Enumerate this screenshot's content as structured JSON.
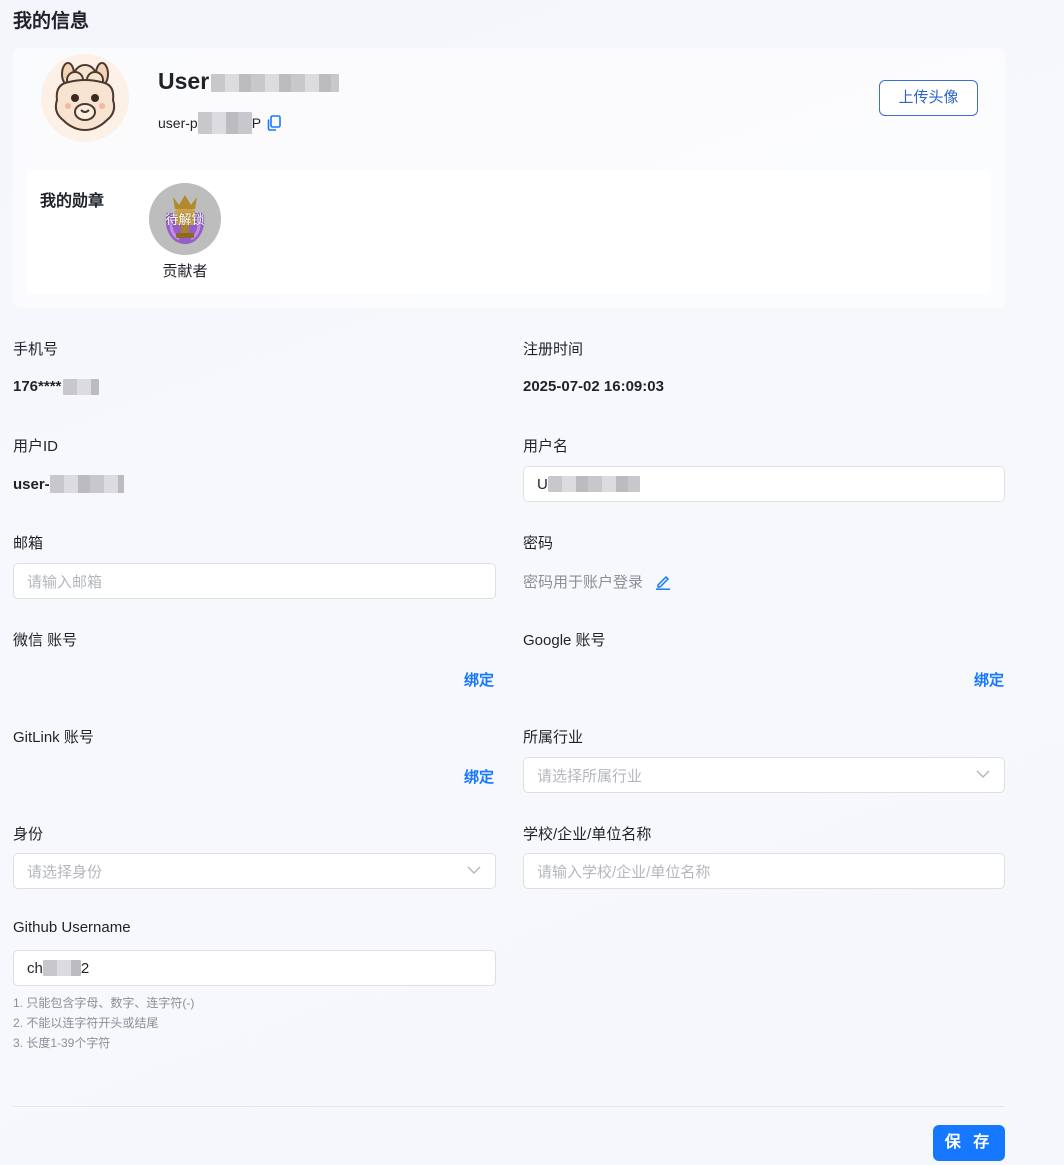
{
  "page": {
    "title": "我的信息"
  },
  "profile": {
    "username_prefix": "User",
    "userid_prefix": "user-p",
    "userid_suffix": "P",
    "upload_label": "上传头像",
    "avatar_icon": "alpaca-avatar",
    "copy_icon": "copy-icon"
  },
  "badges": {
    "title": "我的勋章",
    "items": [
      {
        "name": "贡献者",
        "status": "待解锁"
      }
    ]
  },
  "fields": {
    "phone": {
      "label": "手机号",
      "value": "176****"
    },
    "register_time": {
      "label": "注册时间",
      "value": "2025-07-02 16:09:03"
    },
    "user_id": {
      "label": "用户ID",
      "value": "user-",
      "value_suffix": ""
    },
    "username": {
      "label": "用户名",
      "value": "U"
    },
    "email": {
      "label": "邮箱",
      "placeholder": "请输入邮箱"
    },
    "password": {
      "label": "密码",
      "text": "密码用于账户登录"
    },
    "wechat": {
      "label": "微信 账号",
      "action": "绑定"
    },
    "google": {
      "label": "Google 账号",
      "action": "绑定"
    },
    "gitlink": {
      "label": "GitLink 账号",
      "action": "绑定"
    },
    "industry": {
      "label": "所属行业",
      "placeholder": "请选择所属行业"
    },
    "identity": {
      "label": "身份",
      "placeholder": "请选择身份"
    },
    "organization": {
      "label": "学校/企业/单位名称",
      "placeholder": "请输入学校/企业/单位名称"
    },
    "github": {
      "label": "Github Username",
      "value_prefix": "ch",
      "value_suffix": "2",
      "hints": [
        "1. 只能包含字母、数字、连字符(-)",
        "2. 不能以连字符开头或结尾",
        "3. 长度1-39个字符"
      ]
    }
  },
  "actions": {
    "save_label": "保 存"
  },
  "colors": {
    "primary": "#1677ff",
    "outline": "#3b6fd6",
    "muted": "#8a8f99"
  }
}
